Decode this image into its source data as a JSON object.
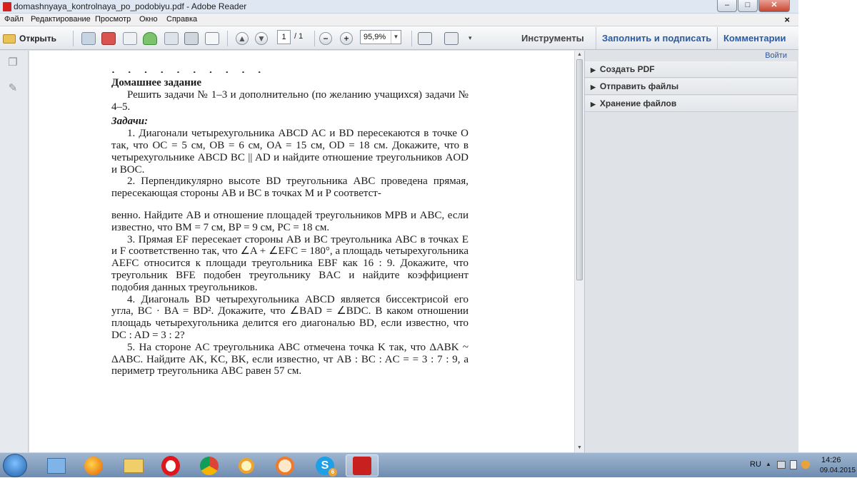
{
  "window": {
    "title": "domashnyaya_kontrolnaya_po_podobiyu.pdf - Adobe Reader",
    "buttons": {
      "minimize": "–",
      "maximize": "□",
      "close": "✕"
    }
  },
  "menu": {
    "items": [
      "Файл",
      "Редактирование",
      "Просмотр",
      "Окно",
      "Справка"
    ],
    "close_doc": "×"
  },
  "toolbar": {
    "open_label": "Открыть",
    "page_current": "1",
    "page_total": "/ 1",
    "zoom": "95,9%",
    "tabs": {
      "tools": "Инструменты",
      "fill_sign": "Заполнить и подписать",
      "comments": "Комментарии"
    }
  },
  "right_pane": {
    "signin": "Войти",
    "items": [
      "Создать PDF",
      "Отправить файлы",
      "Хранение файлов"
    ]
  },
  "document": {
    "cut_line": "· · · · · · · · · ·",
    "homework_title": "Домашнее задание",
    "intro": "Решить задачи № 1–3 и дополнительно (по желанию учащихся) задачи № 4–5.",
    "tasks_heading": "Задачи:",
    "task1": "1. Диагонали четырехугольника ABCD AC и BD пересекаются в точке O так, что OC = 5 см, OB = 6 см, OA = 15 см, OD = 18 см. Докажите, что в четырехугольнике ABCD BC || AD и найдите отношение треугольников AOD и BOC.",
    "task2a": "2. Перпендикулярно высоте BD треугольника ABC проведена прямая, пересекающая стороны AB и BC в точках M и P соответст-",
    "task2b": "венно. Найдите AB и отношение площадей треугольников MPB и ABC, если известно, что BM = 7 см, BP = 9 см, PC = 18 см.",
    "task3": "3. Прямая EF пересекает стороны AB и BC треугольника ABC в точках E и F соответственно так, что ∠A + ∠EFC = 180°, а площадь четырехугольника AEFC относится к площади треугольника EBF как 16 : 9. Докажите, что треугольник BFE подобен треугольнику BAC и найдите коэффициент подобия данных треугольников.",
    "task4": "4. Диагональ BD четырехугольника ABCD является биссектрисой его угла, BC · BA = BD². Докажите, что ∠BAD = ∠BDC. В каком отношении площадь четырехугольника делится его диагональю BD, если известно, что DC : AD = 3 : 2?",
    "task5": "5. На стороне AC треугольника ABC отмечена точка K так, что ΔABK ~ ΔABC. Найдите AK, KC, BK, если известно, чт AB : BC : AC = = 3 : 7 : 9, а периметр треугольника ABC равен 57 см."
  },
  "taskbar": {
    "lang": "RU",
    "time": "14:26",
    "date": "09.04.2015",
    "apps": [
      "explorer-app",
      "firefox-app",
      "files-app",
      "opera-app",
      "chrome-app",
      "search-app",
      "mail-app",
      "skype-app",
      "adobe-reader-app"
    ],
    "skype_badge": "6"
  },
  "colors": {
    "accent_link": "#2a5aa0",
    "reader_red": "#d32020"
  }
}
